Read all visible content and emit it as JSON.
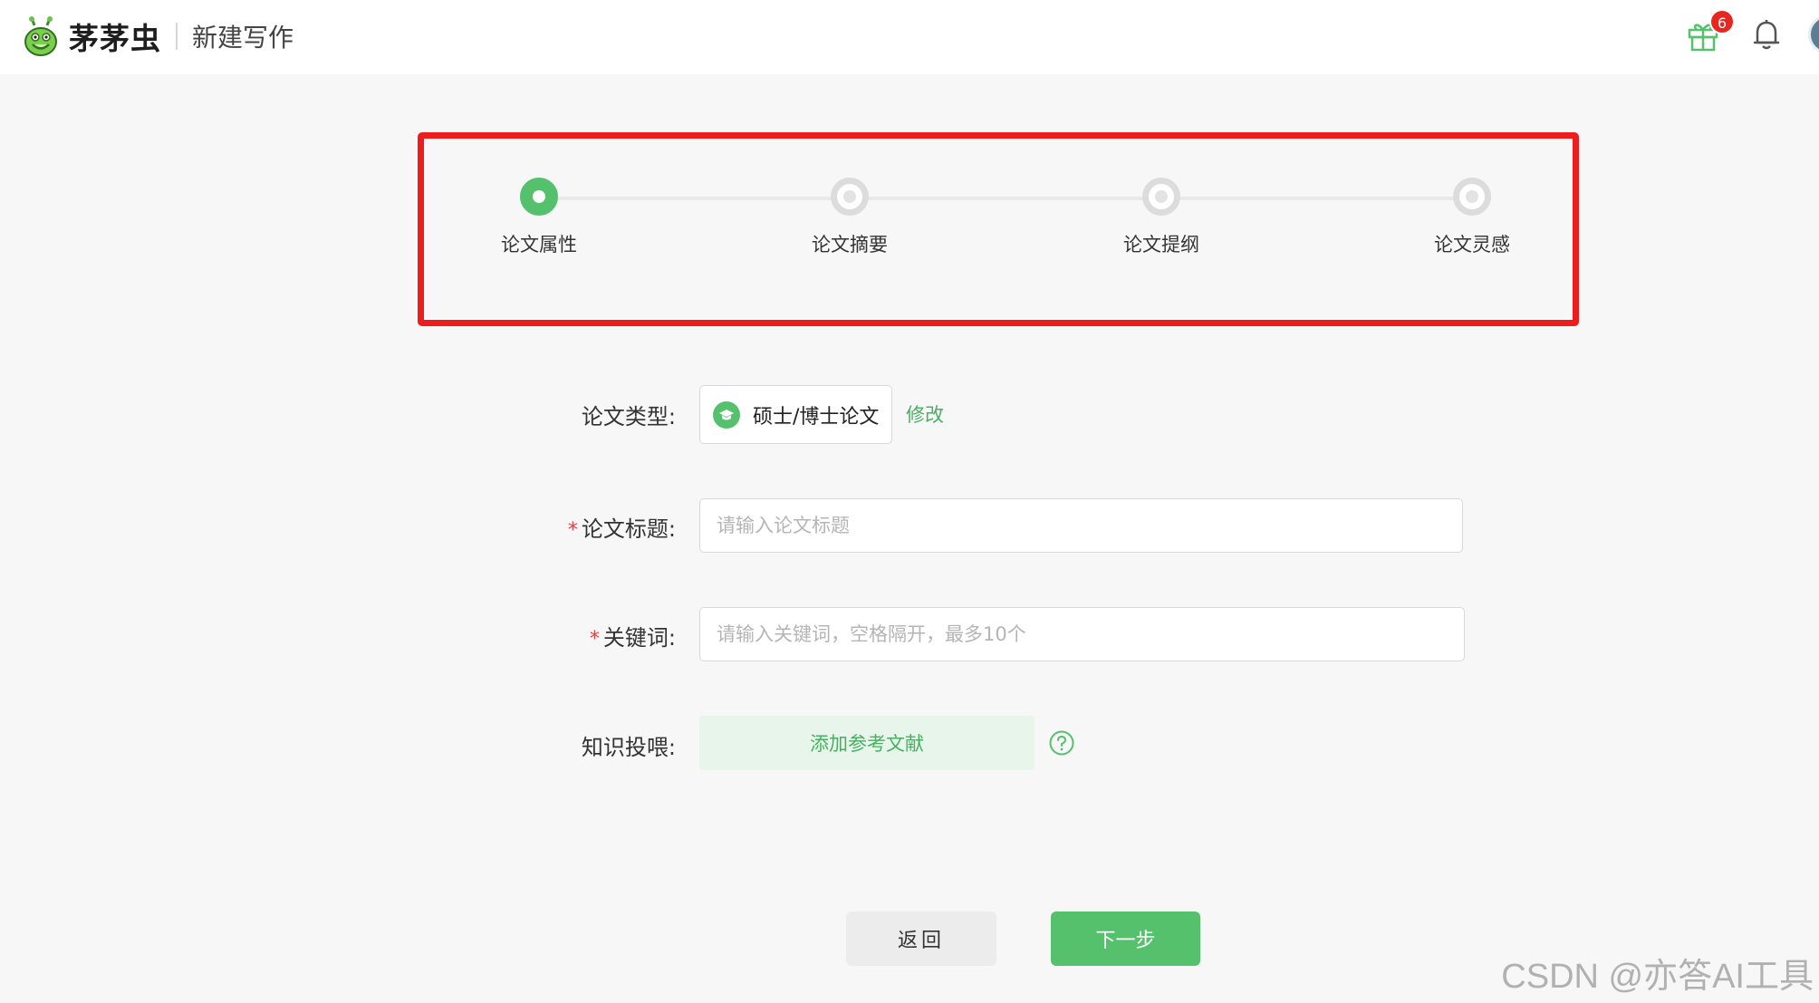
{
  "header": {
    "brand": "茅茅虫",
    "page_title": "新建写作",
    "gift_badge_count": "6"
  },
  "steps": [
    {
      "label": "论文属性",
      "active": true
    },
    {
      "label": "论文摘要",
      "active": false
    },
    {
      "label": "论文提纲",
      "active": false
    },
    {
      "label": "论文灵感",
      "active": false
    }
  ],
  "form": {
    "type_label": "论文类型:",
    "type_value": "硕士/博士论文",
    "modify_label": "修改",
    "required_mark": "*",
    "title_label": "论文标题:",
    "title_placeholder": "请输入论文标题",
    "keywords_label": "关键词:",
    "keywords_placeholder": "请输入关键词，空格隔开，最多10个",
    "knowledge_label": "知识投喂:",
    "add_reference_label": "添加参考文献"
  },
  "footer": {
    "back_label": "返回",
    "next_label": "下一步"
  },
  "watermark": "CSDN @亦答AI工具",
  "colors": {
    "accent": "#55c16d",
    "highlight_border": "#ee1d1d",
    "badge": "#e8261f"
  }
}
